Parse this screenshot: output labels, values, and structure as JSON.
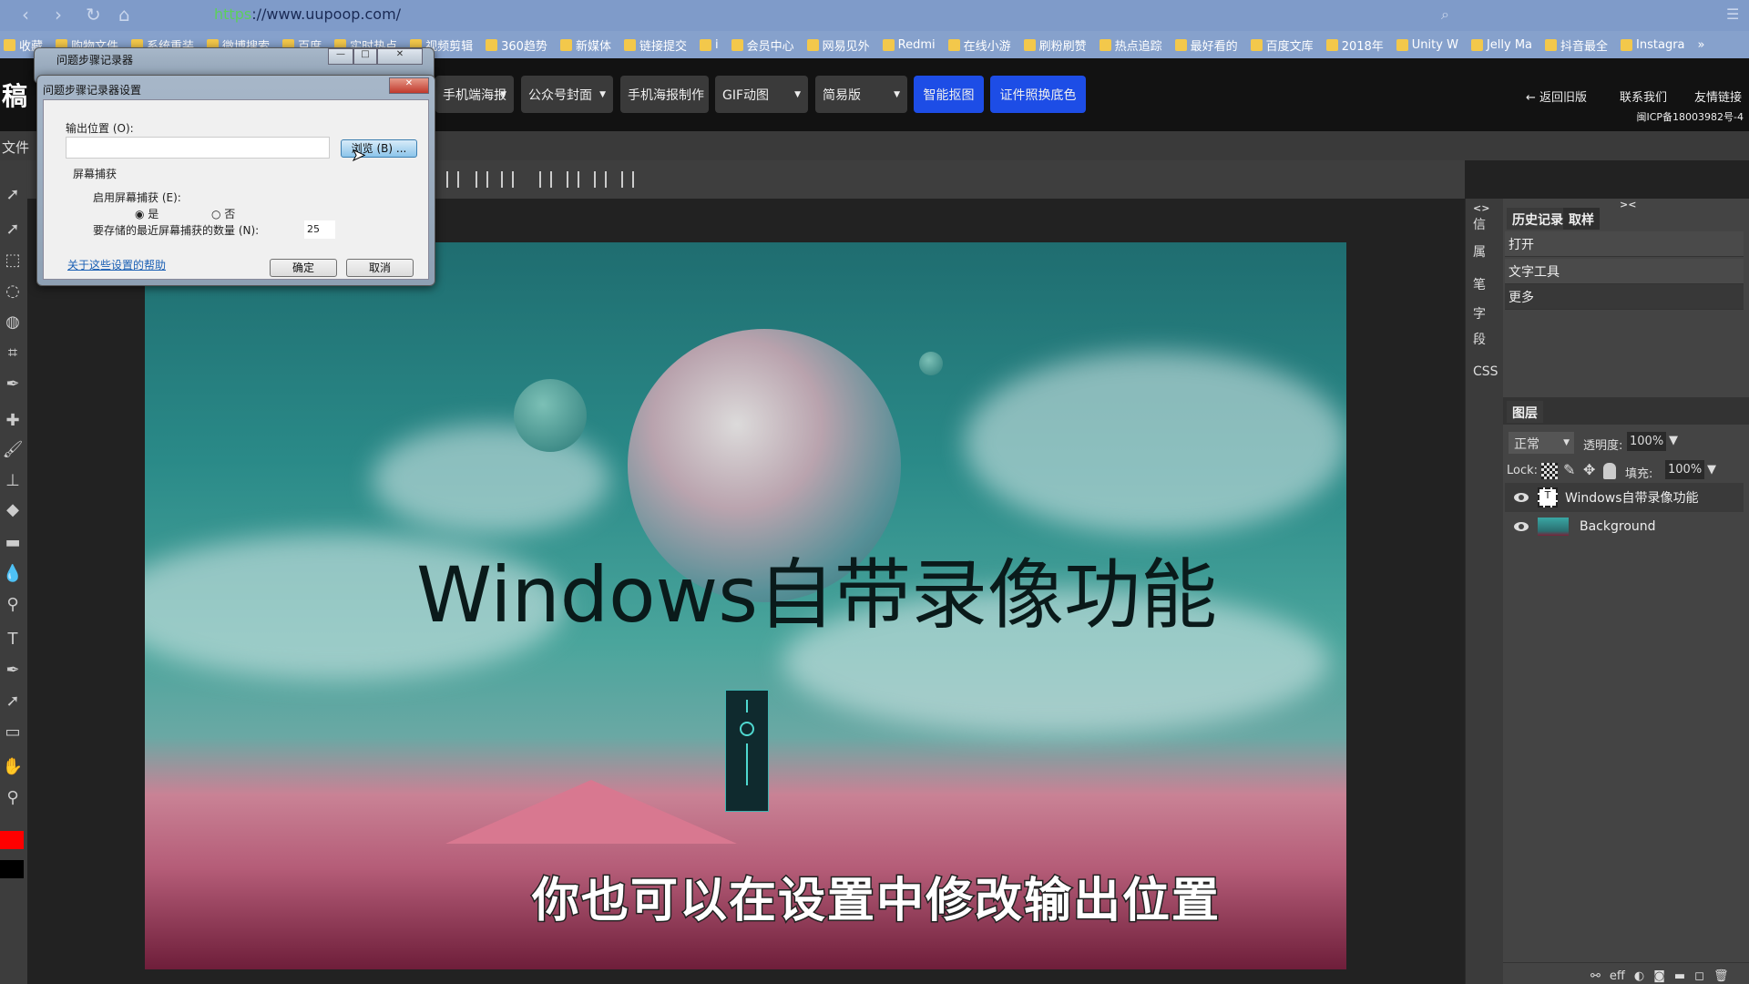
{
  "browser": {
    "url_scheme": "https",
    "url_rest": "://www.uupoop.com/",
    "bookmarks": [
      "收藏",
      "购物文件",
      "系统重装",
      "微博搜索",
      "百度",
      "实时热点",
      "视频剪辑",
      "360趋势",
      "新媒体",
      "链接提交",
      "i",
      "会员中心",
      "网易见外",
      "Redmi",
      "在线小游",
      "刷粉刷赞",
      "热点追踪",
      "最好看的",
      "百度文库",
      "2018年",
      "Unity W",
      "Jelly Ma",
      "抖音最全",
      "Instagra",
      "»"
    ]
  },
  "app": {
    "logo": "稿",
    "nav": [
      {
        "label": "手机端海报",
        "dropdown": true
      },
      {
        "label": "公众号封面",
        "dropdown": true
      },
      {
        "label": "手机海报制作",
        "dropdown": false
      },
      {
        "label": "GIF动图",
        "dropdown": true
      },
      {
        "label": "简易版",
        "dropdown": true
      },
      {
        "label": "智能抠图",
        "accent": true
      },
      {
        "label": "证件照换底色",
        "accent": true
      }
    ],
    "links": [
      "← 返回旧版",
      "联系我们",
      "友情链接"
    ],
    "icp": "闽ICP备18003982号-4",
    "menu_file": "文件",
    "accent": "#1d4de6"
  },
  "canvas": {
    "title_text": "Windows自带录像功能",
    "subtitle": "你也可以在设置中修改输出位置"
  },
  "strip": [
    "<>",
    "信",
    "属",
    "笔",
    "字",
    "段",
    "CSS"
  ],
  "panel": {
    "collapse": "><",
    "tabs": [
      "历史记录",
      "取样"
    ],
    "history": [
      "打开",
      "文字工具",
      "更多"
    ],
    "layers_tab": "图层",
    "blend_mode": "正常",
    "opacity_label": "透明度:",
    "opacity": "100%",
    "lock_label": "Lock:",
    "fill_label": "填充:",
    "fill": "100%",
    "layers": [
      {
        "name": "Windows自带录像功能",
        "type": "text"
      },
      {
        "name": "Background",
        "type": "image"
      }
    ],
    "footer_eff": "eff"
  },
  "psr": {
    "title": "问题步骤记录器"
  },
  "settings": {
    "title": "问题步骤记录器设置",
    "output_label": "输出位置 (O):",
    "output_value": "",
    "browse": "浏览 (B) ...",
    "group": "屏幕捕获",
    "enable_label": "启用屏幕捕获 (E):",
    "yes": "是",
    "no": "否",
    "enabled": true,
    "count_label": "要存储的最近屏幕捕获的数量 (N):",
    "count": "25",
    "help_link": "关于这些设置的帮助",
    "ok": "确定",
    "cancel": "取消"
  }
}
